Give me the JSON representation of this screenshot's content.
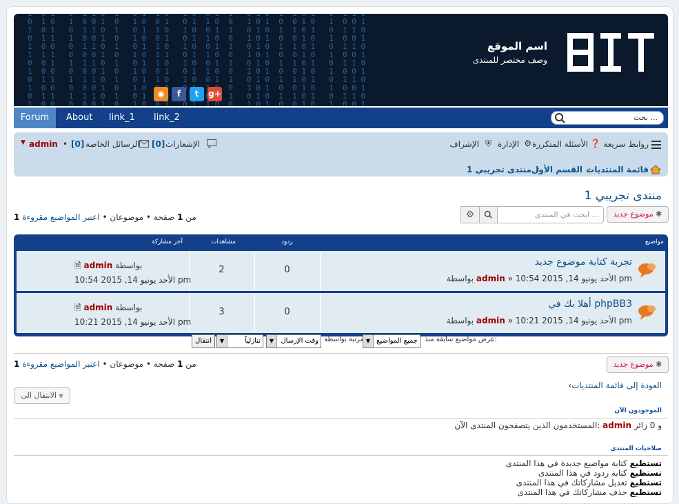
{
  "header": {
    "site_title": "اسم الموقع",
    "site_desc": "وصف مختصر للمنتدى",
    "social": [
      {
        "name": "rss",
        "glyph": "◉",
        "color": "#f08a24"
      },
      {
        "name": "facebook",
        "glyph": "f",
        "color": "#3b5998"
      },
      {
        "name": "twitter",
        "glyph": "t",
        "color": "#1da1f2"
      },
      {
        "name": "google-plus",
        "glyph": "g+",
        "color": "#dd4b39"
      }
    ]
  },
  "nav": {
    "items": [
      "Forum",
      "About",
      "link_1",
      "link_2"
    ],
    "search_placeholder": "بحث ..."
  },
  "navbar": {
    "quick_links": "روابط سريعة",
    "faq": "الأسئلة المتكررة",
    "admin": "الإدارة",
    "moderate": "الإشراف",
    "notifications": "الإشعارات",
    "notif_count": "[0]",
    "pm": "الرسائل الخاصة",
    "pm_count": "[0]",
    "user": "admin",
    "breadcrumbs": [
      "قائمة المنتديات",
      "القسم الأول",
      "منتدى تجريبي 1"
    ]
  },
  "forum": {
    "title": "منتدى تجريبي 1",
    "new_topic": "موضوع جديد",
    "search_placeholder": "ابحث في المنتدى ...",
    "page_info_mark": "اعتبر المواضيع مقروءة",
    "page_info_topics": "موضوعان",
    "page_info_page": "صفحة",
    "page_current": "1",
    "page_of": "من",
    "page_total": "1",
    "bullet": "•"
  },
  "table": {
    "headers": {
      "topics": "مواضيع",
      "replies": "ردود",
      "views": "مشاهدات",
      "last_post": "آخر مشاركة"
    },
    "rows": [
      {
        "title": "تجربة كتابة موضوع جديد",
        "by": "بواسطة",
        "author": "admin",
        "date": "الأحد يونيو 14, 2015 10:54 pm",
        "replies": "0",
        "views": "2",
        "lp_by": "بواسطة",
        "lp_author": "admin",
        "lp_date": "الأحد يونيو 14, 2015 10:54 pm"
      },
      {
        "title": "أهلا بك في phpBB3",
        "by": "بواسطة",
        "author": "admin",
        "date": "الأحد يونيو 14, 2015 10:21 pm",
        "replies": "0",
        "views": "3",
        "lp_by": "بواسطة",
        "lp_author": "admin",
        "lp_date": "الأحد يونيو 14, 2015 10:21 pm"
      }
    ]
  },
  "filter": {
    "label_show": "عرض مواضيع سابقة منذ:",
    "show_value": "جميع المواضيع",
    "label_sort": "مرتبة بواسطة",
    "sort_value": "وقت الإرسال",
    "dir_value": "تنازلياً",
    "go": "انتقال"
  },
  "footer": {
    "back": "العودة إلى قائمة المنتديات",
    "jump": "الانتقال الى",
    "online_title": "الموجودون الآن",
    "online_text": "المستخدمون الذين يتصفحون المنتدى الآن:",
    "online_user": "admin",
    "online_guests": "و 0 زائر",
    "perm_title": "صلاحيات المنتدى",
    "perm_can": "تستطيع",
    "perms": [
      "كتابة مواضيع جديدة في هذا المنتدى",
      "كتابة ردود في هذا المنتدى",
      "تعديل مشاركاتك في هذا المنتدى",
      "حذف مشاركاتك في هذا المنتدى"
    ]
  }
}
